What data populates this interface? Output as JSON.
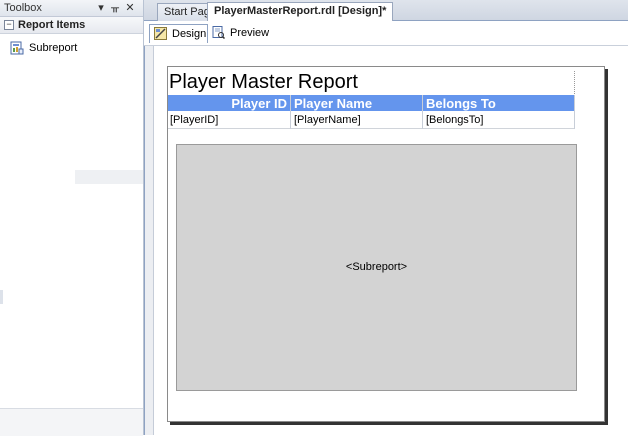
{
  "toolbox": {
    "title": "Toolbox",
    "controls": {
      "dropdown": "▾",
      "pin": "ᚂ",
      "close": "✕"
    },
    "section_label": "Report Items",
    "section_toggle": "⊟",
    "items": [
      {
        "label": "Subreport",
        "icon": "subreport-icon"
      }
    ]
  },
  "tabs": [
    {
      "label": "Start Page",
      "active": false
    },
    {
      "label": "PlayerMasterReport.rdl [Design]*",
      "active": true
    }
  ],
  "subtabs": [
    {
      "label": "Design",
      "icon": "design-icon",
      "active": true
    },
    {
      "label": "Preview",
      "icon": "preview-icon",
      "active": false
    }
  ],
  "report": {
    "title": "Player Master Report",
    "columns": [
      {
        "header": "Player ID",
        "field": "[PlayerID]"
      },
      {
        "header": "Player Name",
        "field": "[PlayerName]"
      },
      {
        "header": "Belongs To",
        "field": "[BelongsTo]"
      }
    ],
    "subreport_placeholder": "<Subreport>"
  },
  "colors": {
    "header_bg": "#6495ed",
    "subreport_bg": "#d3d3d3"
  }
}
